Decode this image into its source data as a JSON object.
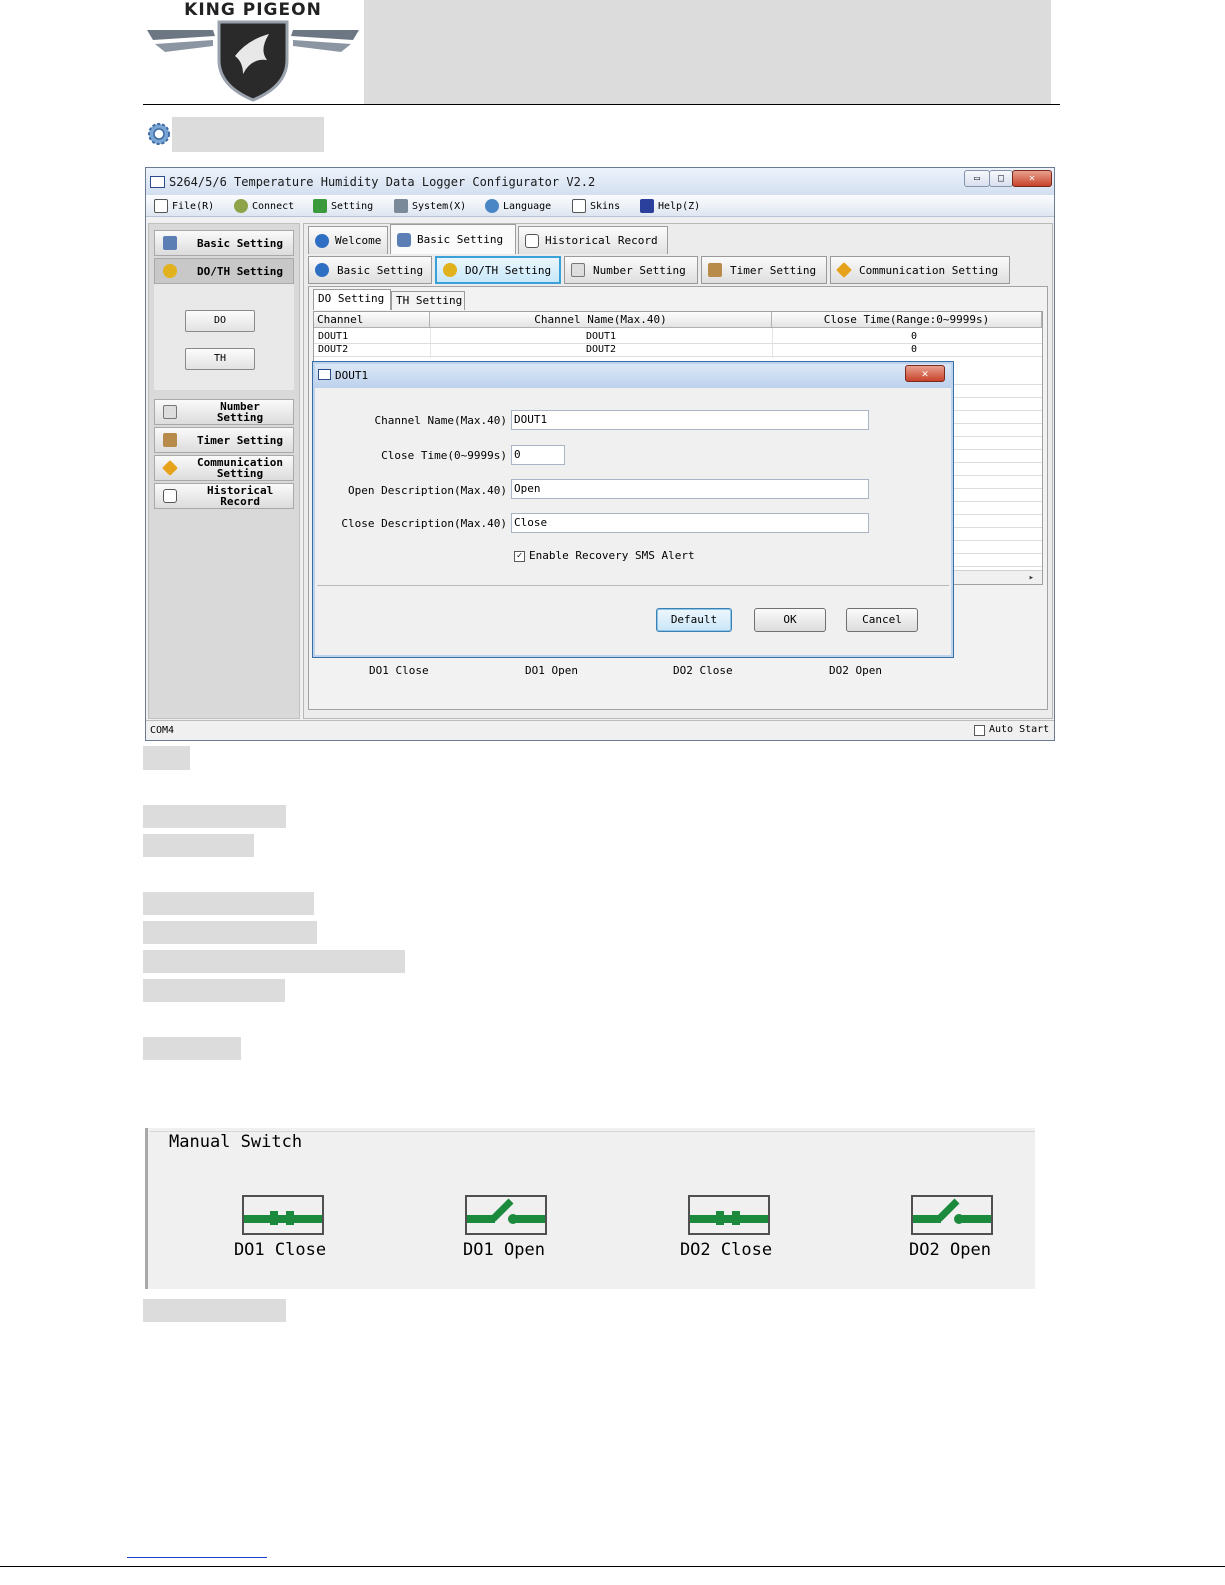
{
  "header": {
    "brand": "KING PIGEON"
  },
  "app": {
    "title": "S264/5/6 Temperature Humidity Data Logger Configurator  V2.2",
    "window_controls": {
      "minimize": "▭",
      "maximize": "□",
      "close": "✕"
    },
    "menu": [
      "File(R)",
      "Connect",
      "Setting",
      "System(X)",
      "Language",
      "Skins",
      "Help(Z)"
    ],
    "sidebar": {
      "basic_setting": "Basic Setting",
      "do_th_setting": "DO/TH Setting",
      "do_button": "DO",
      "th_button": "TH",
      "number_setting": "Number Setting",
      "timer_setting": "Timer Setting",
      "communication_setting": "Communication Setting",
      "historical_record": "Historical Record"
    },
    "main_tabs": [
      "Welcome",
      "Basic Setting",
      "Historical Record"
    ],
    "sub_tabs": [
      "Basic Setting",
      "DO/TH Setting",
      "Number Setting",
      "Timer Setting",
      "Communication Setting"
    ],
    "inner_tabs": [
      "DO Setting",
      "TH Setting"
    ],
    "table": {
      "columns": [
        "Channel",
        "Channel Name(Max.40)",
        "Close Time(Range:0~9999s)"
      ],
      "rows": [
        {
          "channel": "DOUT1",
          "name": "DOUT1",
          "close_time": "0"
        },
        {
          "channel": "DOUT2",
          "name": "DOUT2",
          "close_time": "0"
        }
      ]
    },
    "switch_labels": [
      "DO1 Close",
      "DO1 Open",
      "DO2 Close",
      "DO2 Open"
    ],
    "status": {
      "port": "COM4",
      "auto_start": "Auto Start"
    }
  },
  "dialog": {
    "title": "DOUT1",
    "close": "✕",
    "fields": {
      "channel_name_label": "Channel Name(Max.40)",
      "channel_name_value": "DOUT1",
      "close_time_label": "Close Time(0~9999s)",
      "close_time_value": "0",
      "open_desc_label": "Open Description(Max.40)",
      "open_desc_value": "Open",
      "close_desc_label": "Close Description(Max.40)",
      "close_desc_value": "Close"
    },
    "checkbox": {
      "label": "Enable Recovery SMS Alert",
      "checked": true
    },
    "buttons": {
      "default": "Default",
      "ok": "OK",
      "cancel": "Cancel"
    }
  },
  "manual_switch": {
    "title": "Manual Switch",
    "switches": [
      "DO1 Close",
      "DO1 Open",
      "DO2 Close",
      "DO2 Open"
    ]
  },
  "colors": {
    "switch_green": "#1b8a3c",
    "accent_blue": "#3aa0d8"
  }
}
